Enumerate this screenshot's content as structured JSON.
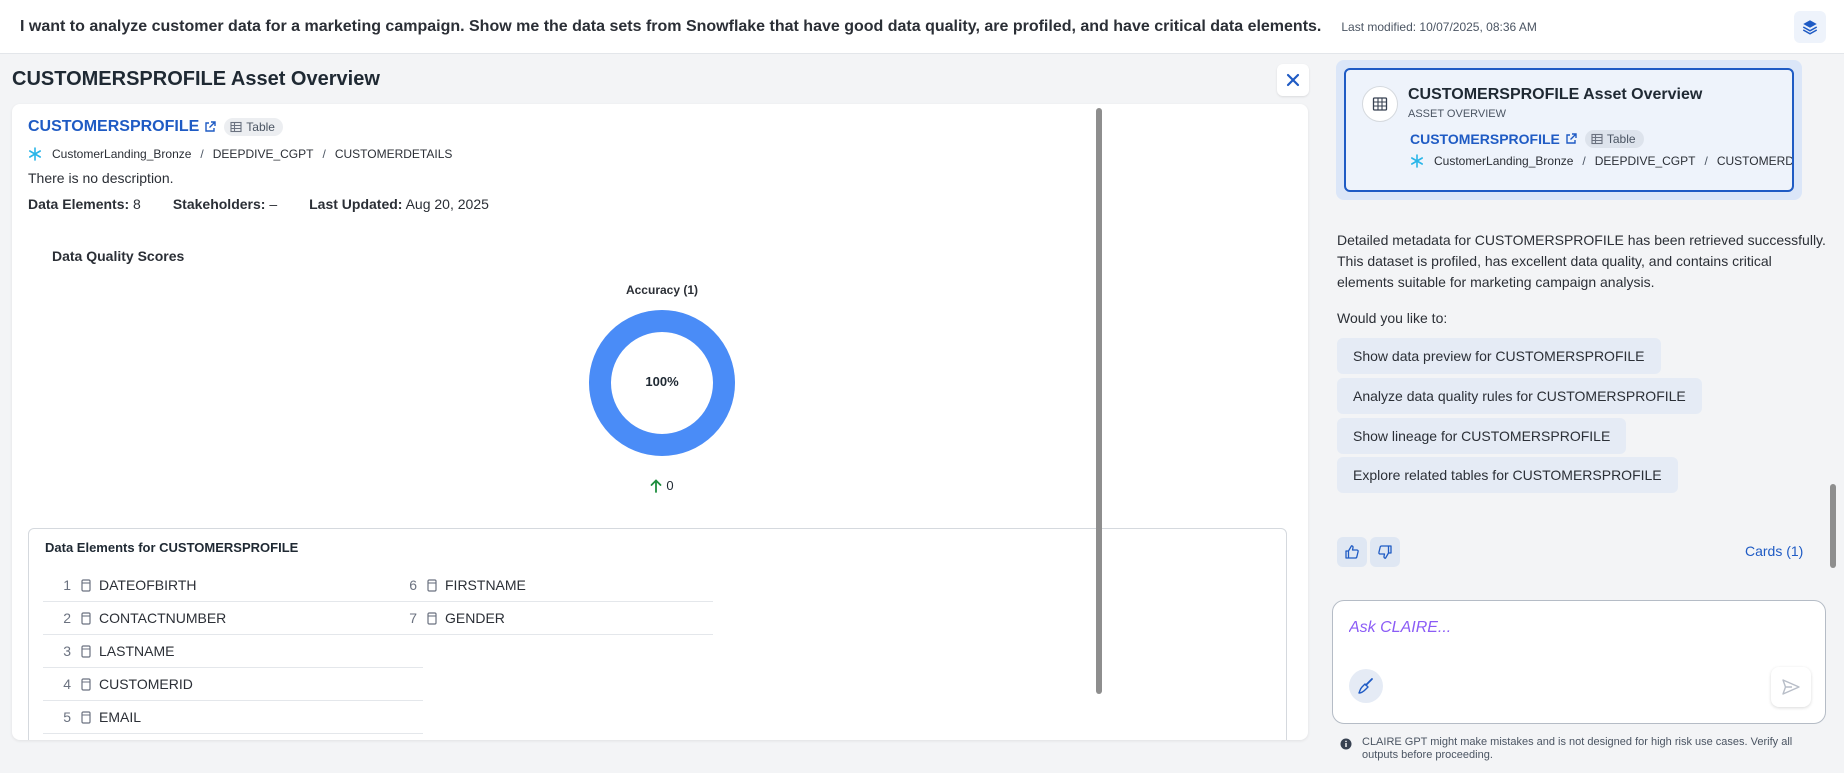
{
  "header": {
    "prompt": "I want to analyze customer data for a marketing campaign. Show me the data sets from Snowflake that have good data quality, are profiled, and have critical data elements.",
    "last_modified": "Last modified: 10/07/2025, 08:36 AM",
    "layers_icon": "layers-icon"
  },
  "overview": {
    "title": "CUSTOMERSPROFILE Asset Overview",
    "close_icon": "close-icon",
    "asset_name": "CUSTOMERSPROFILE",
    "type_label": "Table",
    "breadcrumb": [
      "CustomerLanding_Bronze",
      "DEEPDIVE_CGPT",
      "CUSTOMERDETAILS"
    ],
    "description": "There is no description.",
    "stats": {
      "data_elements_label": "Data Elements:",
      "data_elements_value": "8",
      "stakeholders_label": "Stakeholders:",
      "stakeholders_value": "–",
      "last_updated_label": "Last Updated:",
      "last_updated_value": "Aug 20, 2025"
    },
    "data_quality": {
      "title": "Data Quality Scores",
      "metric_label": "Accuracy (1)",
      "score_text": "100%",
      "score_fraction": 1.0,
      "trend_value": "0",
      "ring_color": "#4a8cf7",
      "trend_color": "#1e8e3e"
    },
    "data_elements": {
      "title": "Data Elements for CUSTOMERSPROFILE",
      "column1": [
        {
          "num": "1",
          "name": "DATEOFBIRTH"
        },
        {
          "num": "2",
          "name": "CONTACTNUMBER"
        },
        {
          "num": "3",
          "name": "LASTNAME"
        },
        {
          "num": "4",
          "name": "CUSTOMERID"
        },
        {
          "num": "5",
          "name": "EMAIL"
        }
      ],
      "column2": [
        {
          "num": "6",
          "name": "FIRSTNAME"
        },
        {
          "num": "7",
          "name": "GENDER"
        }
      ]
    }
  },
  "chat": {
    "ref_card": {
      "title": "CUSTOMERSPROFILE Asset Overview",
      "subtitle": "ASSET OVERVIEW",
      "asset_name": "CUSTOMERSPROFILE",
      "type_label": "Table",
      "breadcrumb": [
        "CustomerLanding_Bronze",
        "DEEPDIVE_CGPT",
        "CUSTOMERD"
      ]
    },
    "reply": "Detailed metadata for CUSTOMERSPROFILE has been retrieved successfully. This dataset is profiled, has excellent data quality, and contains critical elements suitable for marketing campaign analysis.",
    "would_you_like": "Would you like to:",
    "suggestions": [
      "Show data preview for CUSTOMERSPROFILE",
      "Analyze data quality rules for CUSTOMERSPROFILE",
      "Show lineage for CUSTOMERSPROFILE",
      "Explore related tables for CUSTOMERSPROFILE"
    ],
    "cards_link": "Cards (1)",
    "ask_placeholder": "Ask CLAIRE...",
    "disclaimer": "CLAIRE GPT might make mistakes and is not designed for high risk use cases. Verify all outputs before proceeding."
  },
  "colors": {
    "accent": "#1f5bc4",
    "snowflake": "#29b5e8"
  }
}
